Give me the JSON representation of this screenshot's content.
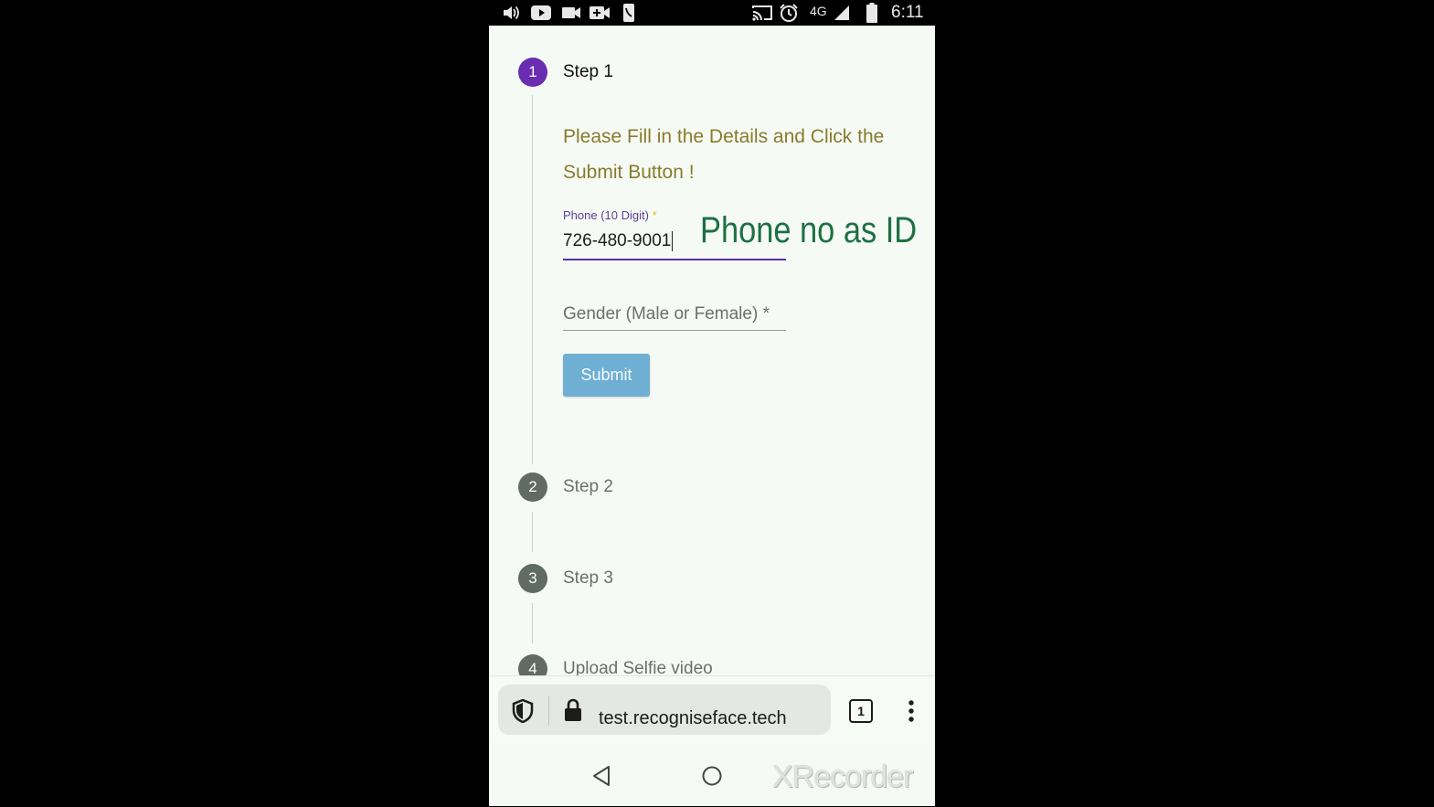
{
  "status_bar": {
    "network": "4G",
    "time": "6:11",
    "icons": [
      "volume-icon",
      "youtube-icon",
      "video-camera-icon",
      "video-call-icon",
      "phone-icon",
      "cast-icon",
      "alarm-icon",
      "signal-icon",
      "battery-icon"
    ]
  },
  "stepper": {
    "steps": [
      {
        "number": "1",
        "label": "Step 1",
        "state": "active"
      },
      {
        "number": "2",
        "label": "Step 2",
        "state": "inactive"
      },
      {
        "number": "3",
        "label": "Step 3",
        "state": "inactive"
      },
      {
        "number": "4",
        "label": "Upload Selfie video",
        "state": "inactive"
      }
    ]
  },
  "form": {
    "instruction": "Please Fill in the Details and Click the Submit Button !",
    "phone_label": "Phone (10 Digit)",
    "required_mark": "*",
    "phone_value": "726-480-9001",
    "gender_placeholder": "Gender (Male or Female) *",
    "submit_label": "Submit"
  },
  "annotation": "Phone no as ID",
  "browser": {
    "url": "test.recogniseface.tech",
    "tab_count": "1"
  },
  "watermark": "XRecorder",
  "colors": {
    "active_step": "#6a2cb0",
    "inactive_step": "#5f6b63",
    "instruction_text": "#8a7a2c",
    "annotation_text": "#1e6f45",
    "submit_button": "#6fafd4",
    "page_background": "#f5fbf4"
  }
}
